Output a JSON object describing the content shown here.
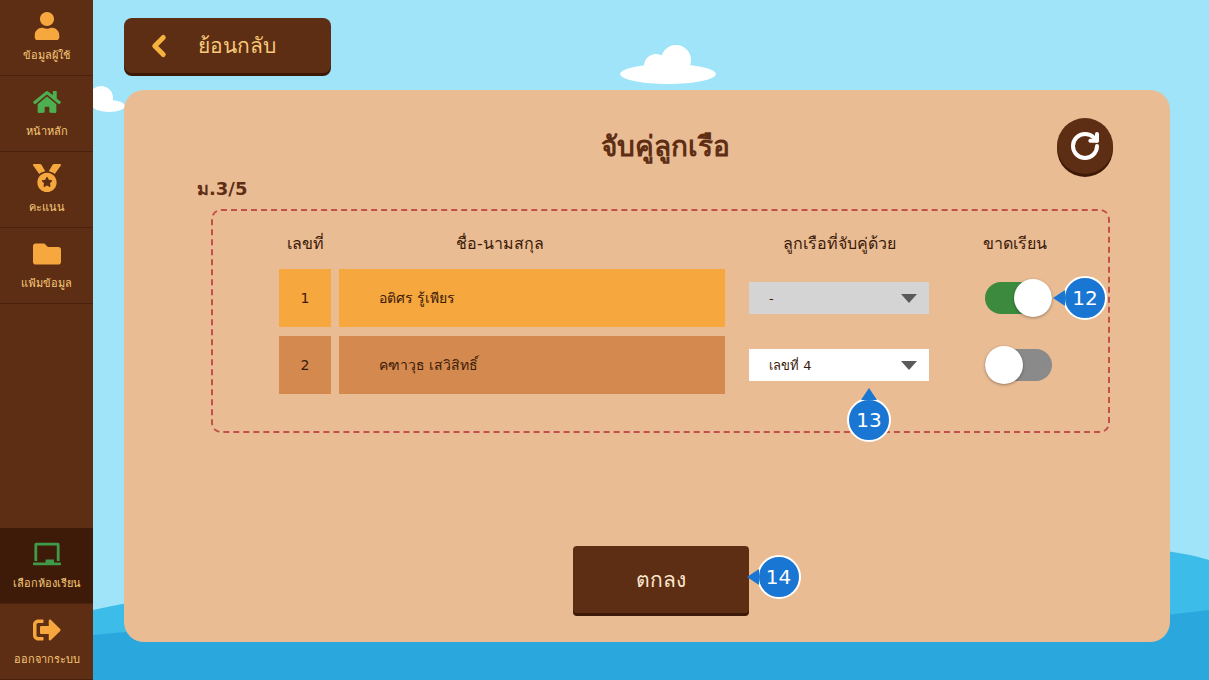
{
  "sidebar": {
    "items": [
      {
        "label": "ข้อมูลผู้ใช้",
        "selected": false
      },
      {
        "label": "หน้าหลัก",
        "selected": false
      },
      {
        "label": "คะแนน",
        "selected": false
      },
      {
        "label": "แฟ้มข้อมูล",
        "selected": false
      }
    ],
    "bottom_items": [
      {
        "label": "เลือกห้องเรียน",
        "selected": true
      },
      {
        "label": "ออกจากระบบ",
        "selected": false
      }
    ]
  },
  "back_button": {
    "label": "ย้อนกลับ"
  },
  "panel": {
    "title": "จับคู่ลูกเรือ",
    "class_name": "ม.3/5"
  },
  "table": {
    "columns": [
      "เลขที่",
      "ชื่อ-นามสกุล",
      "ลูกเรือที่จับคู่ด้วย",
      "ขาดเรียน"
    ],
    "rows": [
      {
        "number": "1",
        "name": "อติศร รู้เพียร",
        "color": "#f6a83e",
        "partner": "-",
        "partner_disabled": true,
        "absent": true,
        "callout": {
          "label": "12",
          "target": "absent"
        }
      },
      {
        "number": "2",
        "name": "คฑาวุธ เสวิสิทธิ์",
        "color": "#d4894f",
        "partner": "เลขที่ 4",
        "partner_disabled": false,
        "absent": false,
        "callout": {
          "label": "13",
          "target": "partner"
        }
      }
    ]
  },
  "confirm_button": {
    "label": "ตกลง",
    "callout": "14"
  }
}
